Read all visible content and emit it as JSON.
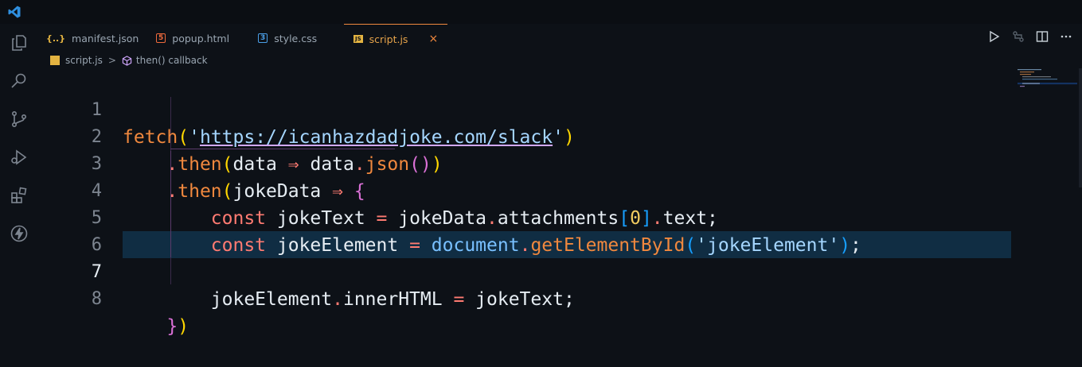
{
  "tabs": [
    {
      "label": "manifest.json",
      "icon": "{..}"
    },
    {
      "label": "popup.html",
      "icon": "5"
    },
    {
      "label": "style.css",
      "icon": "3"
    },
    {
      "label": "script.js",
      "icon": "JS",
      "close": "×"
    }
  ],
  "breadcrumb": {
    "file": "script.js",
    "separator": ">",
    "symbol": "then() callback"
  },
  "line_numbers": [
    "1",
    "2",
    "3",
    "4",
    "5",
    "6",
    "7",
    "8"
  ],
  "code": {
    "l1": {
      "a": "fetch",
      "b": "(",
      "c": "'",
      "d": "https://icanhazdadjoke.com/slack",
      "e": "'",
      "f": ")"
    },
    "l2": {
      "a": ".",
      "b": "then",
      "c": "(",
      "d": "data",
      "e": "⇒",
      "f": "data",
      "g": ".",
      "h": "json",
      "i": "(",
      "j": ")",
      "k": ")"
    },
    "l3": {
      "a": ".",
      "b": "then",
      "c": "(",
      "d": "jokeData",
      "e": "⇒",
      "f": "{"
    },
    "l4": {
      "a": "const",
      "b": "jokeText",
      "c": "=",
      "d": "jokeData",
      "e": ".",
      "f": "attachments",
      "g": "[",
      "h": "0",
      "i": "]",
      "j": ".",
      "k": "text",
      "l": ";"
    },
    "l5": {
      "a": "const",
      "b": "jokeElement",
      "c": "=",
      "d": "document",
      "e": ".",
      "f": "getElementById",
      "g": "(",
      "h": "'jokeElement'",
      "i": ")",
      "j": ";"
    },
    "l7": {
      "a": "jokeElement",
      "b": ".",
      "c": "innerHTML",
      "d": "=",
      "e": "jokeText",
      "f": ";"
    },
    "l8": {
      "a": "}",
      "b": ")"
    }
  },
  "colors": {
    "accent": "#f0883e",
    "current_line": "#102d43",
    "background": "#0d1117"
  }
}
